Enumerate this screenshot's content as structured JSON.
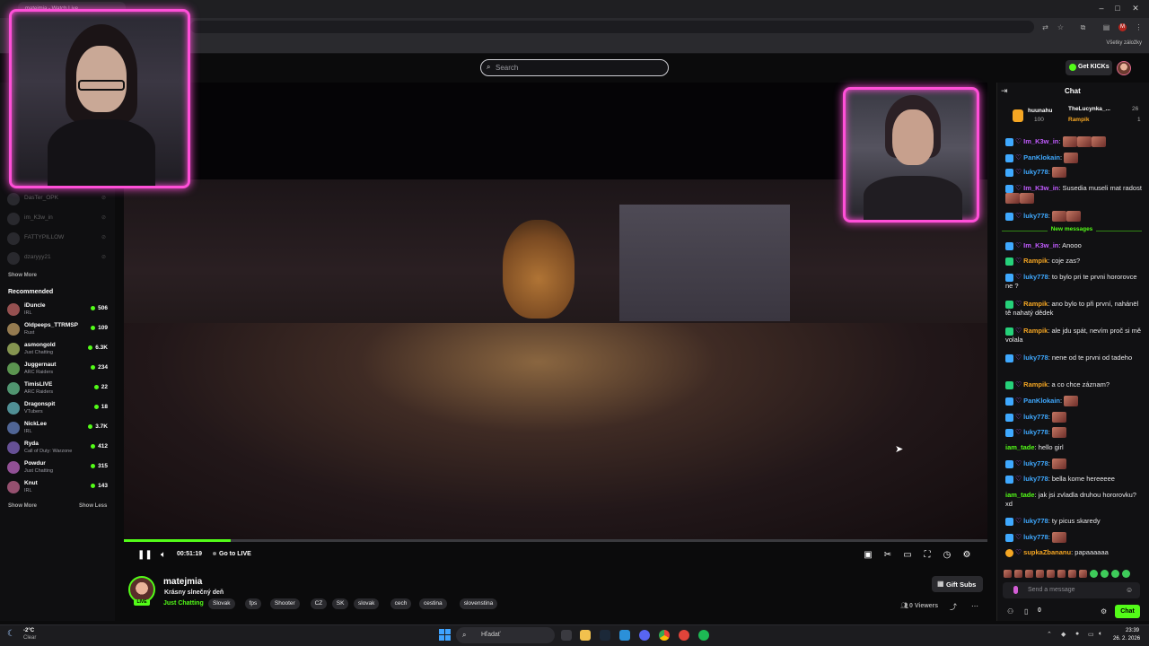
{
  "browser": {
    "tab_title": "matejmia - Watch Live",
    "bookmarks_label": "Všetky záložky"
  },
  "header": {
    "search_placeholder": "Search",
    "get_kicks_label": "Get KICKs"
  },
  "sidebar": {
    "offline_channels": [
      "DasTer_OPK",
      "im_K3w_in",
      "FATTYPILLOW",
      "dzaryyy21"
    ],
    "show_more_label": "Show More",
    "recommended_label": "Recommended",
    "recommended": [
      {
        "name": "iDuncle",
        "category": "IRL",
        "viewers": "506"
      },
      {
        "name": "Oldpeeps_TTRMSP",
        "category": "Rust",
        "viewers": "109"
      },
      {
        "name": "asmongold",
        "category": "Just Chatting",
        "viewers": "6.3K"
      },
      {
        "name": "Juggernaut",
        "category": "ARC Raiders",
        "viewers": "234"
      },
      {
        "name": "TimisLIVE",
        "category": "ARC Raiders",
        "viewers": "22"
      },
      {
        "name": "Dragonspit",
        "category": "VTubers",
        "viewers": "18"
      },
      {
        "name": "NickLee",
        "category": "IRL",
        "viewers": "3.7K"
      },
      {
        "name": "Ryda",
        "category": "Call of Duty: Warzone",
        "viewers": "412"
      },
      {
        "name": "Powdur",
        "category": "Just Chatting",
        "viewers": "315"
      },
      {
        "name": "Knut",
        "category": "IRL",
        "viewers": "143"
      }
    ],
    "show_more_label_2": "Show More",
    "show_less_label": "Show Less"
  },
  "player": {
    "elapsed": "00:51:19",
    "go_live_label": "Go to LIVE",
    "progress_fraction": 0.124
  },
  "stream": {
    "streamer": "matejmia",
    "live_badge": "LIVE",
    "title": "Krásny slnečný deň",
    "category": "Just Chatting",
    "tags": [
      "Slovak",
      "fps",
      "Shooter",
      "CZ",
      "SK",
      "slovak",
      "cech",
      "cestina",
      "slovenstina"
    ],
    "gift_subs_label": "Gift Subs",
    "viewers": "0 Viewers"
  },
  "chat": {
    "title": "Chat",
    "gifters": [
      {
        "name": "huunahu",
        "count": "100"
      },
      {
        "name": "TheLucynka_...",
        "count": "26"
      },
      {
        "name": "Rampik",
        "count": "1"
      }
    ],
    "messages_before": [
      {
        "user": "Im_K3w_in",
        "color": "#c15bff",
        "text": "",
        "emotes": 3
      },
      {
        "user": "PanKlokain",
        "color": "#3fa9ff",
        "text": "",
        "emotes": 1
      },
      {
        "user": "luky778",
        "color": "#3fa9ff",
        "text": "",
        "emotes": 1
      },
      {
        "user": "Im_K3w_in",
        "color": "#c15bff",
        "text": "Susedia museli mat radost",
        "emotes": 2
      },
      {
        "user": "luky778",
        "color": "#3fa9ff",
        "text": "",
        "emotes": 2
      }
    ],
    "new_messages_label": "New messages",
    "messages_after": [
      {
        "user": "Im_K3w_in",
        "color": "#c15bff",
        "text": "Anooo"
      },
      {
        "user": "Rampik",
        "color": "#f5a623",
        "text": "coje zas?"
      },
      {
        "user": "luky778",
        "color": "#3fa9ff",
        "text": "to bylo pri te prvni hororovce ne ?"
      },
      {
        "user": "Rampik",
        "color": "#f5a623",
        "text": "ano bylo to při první, nahánël tě nahatý dědek"
      },
      {
        "user": "Rampik",
        "color": "#f5a623",
        "text": "ale jdu spát, nevím proč si mě volala"
      },
      {
        "user": "luky778",
        "color": "#3fa9ff",
        "text": "nene od te prvni od tadeho"
      },
      {
        "user": "Rampik",
        "color": "#f5a623",
        "text": "a co chce záznam?"
      },
      {
        "user": "PanKlokain",
        "color": "#3fa9ff",
        "text": ""
      },
      {
        "user": "luky778",
        "color": "#3fa9ff",
        "text": ""
      },
      {
        "user": "luky778",
        "color": "#3fa9ff",
        "text": ""
      },
      {
        "user": "iam_tade",
        "color": "#53fc18",
        "text": "hello girl"
      },
      {
        "user": "luky778",
        "color": "#3fa9ff",
        "text": ""
      },
      {
        "user": "luky778",
        "color": "#3fa9ff",
        "text": "bella kome hereeeee"
      },
      {
        "user": "iam_tade",
        "color": "#53fc18",
        "text": "jak jsi zvladla druhou hororovku? xd"
      },
      {
        "user": "luky778",
        "color": "#3fa9ff",
        "text": "ty picus skaredy"
      },
      {
        "user": "luky778",
        "color": "#3fa9ff",
        "text": ""
      },
      {
        "user": "supkaZbananu",
        "color": "#f5a623",
        "text": "papaaaaaa"
      }
    ],
    "send_placeholder": "Send a message",
    "bottom_count": "0",
    "chat_button": "Chat"
  },
  "taskbar": {
    "temperature": "-2°C",
    "weather": "Clear",
    "search_placeholder": "Hľadať",
    "time": "23:39",
    "date": "26. 2. 2026"
  }
}
